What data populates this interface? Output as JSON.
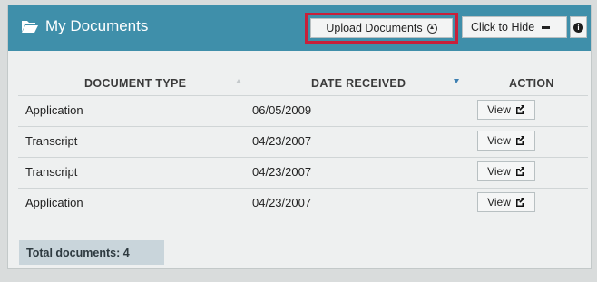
{
  "header": {
    "title": "My Documents",
    "upload_label": "Upload Documents",
    "hide_label": "Click to Hide",
    "info_label": "i"
  },
  "table": {
    "columns": [
      "DOCUMENT TYPE",
      "DATE RECEIVED",
      "ACTION"
    ],
    "sorted_column": "DATE RECEIVED",
    "sort_direction": "descending",
    "rows": [
      {
        "type": "Application",
        "date": "06/05/2009",
        "action": "View"
      },
      {
        "type": "Transcript",
        "date": "04/23/2007",
        "action": "View"
      },
      {
        "type": "Transcript",
        "date": "04/23/2007",
        "action": "View"
      },
      {
        "type": "Application",
        "date": "04/23/2007",
        "action": "View"
      }
    ]
  },
  "footer": {
    "total_label": "Total documents: 4"
  },
  "colors": {
    "header_bg": "#3f8faa",
    "highlight_border": "#c8203a",
    "footer_bg": "#c9d5db"
  }
}
